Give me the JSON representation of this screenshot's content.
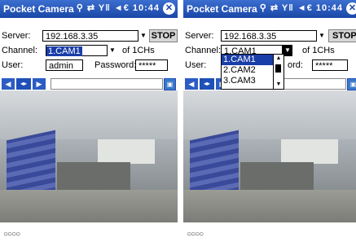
{
  "left": {
    "app_title": "Pocket Camera",
    "status_icons": "⚲ ⇄ Y‖ ◄€ 10:44",
    "close_icon": "✕",
    "server_label": "Server:",
    "server_value": "192.168.3.35",
    "stop_label": "STOP",
    "channel_label": "Channel:",
    "channel_value": "1.CAM1",
    "channel_count": "of 1CHs",
    "user_label": "User:",
    "user_value": "admin",
    "password_label": "Password:",
    "password_value": "*****",
    "progress_dots": "○○○○"
  },
  "right": {
    "app_title": "Pocket Camera",
    "status_icons": "⚲ ⇄ Y‖ ◄€ 10:44",
    "close_icon": "✕",
    "server_label": "Server:",
    "server_value": "192.168.3.35",
    "stop_label": "STOP",
    "channel_label": "Channel:",
    "channel_value": "1.CAM1",
    "channel_count": "of 1CHs",
    "user_label": "User:",
    "password_partial": "ord:",
    "password_value": "*****",
    "dropdown_options": [
      "1.CAM1",
      "2.CAM2",
      "3.CAM3"
    ],
    "progress_dots": "○○○○"
  },
  "icons": {
    "prev": "◀",
    "mid": "◂▸",
    "next": "▶",
    "fullscreen": "▣"
  }
}
